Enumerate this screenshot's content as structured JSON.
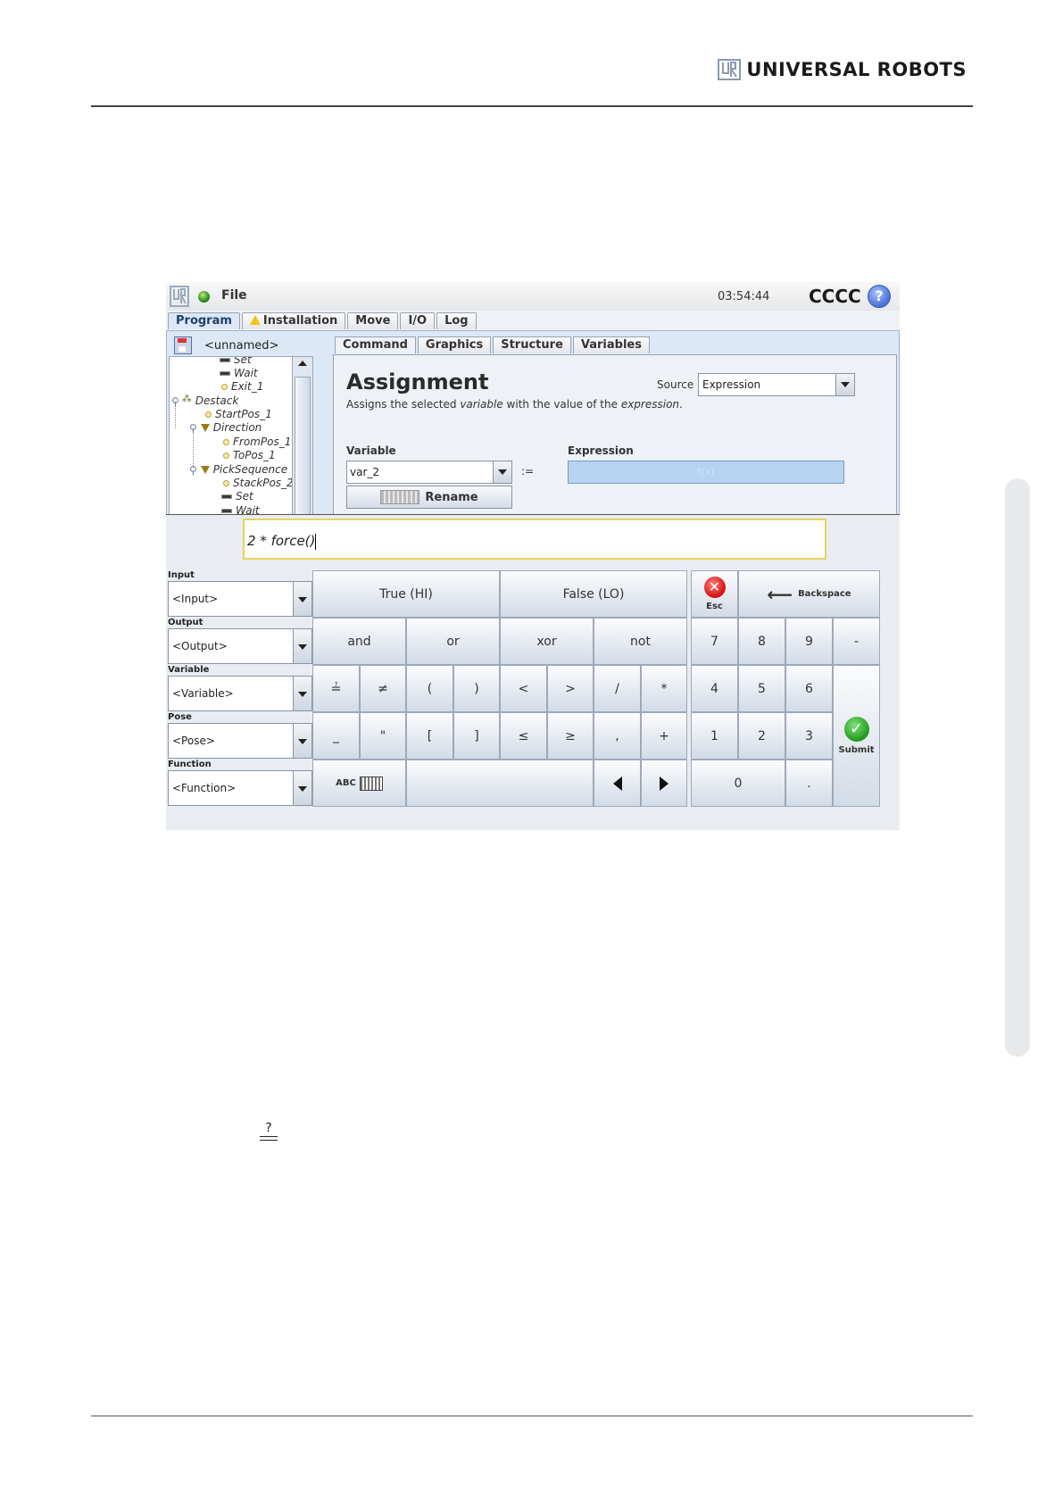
{
  "page": {
    "brand": "UNIVERSAL ROBOTS",
    "qeq_symbol_question": "?",
    "qeq_symbol_equals": "="
  },
  "window": {
    "menu_file": "File",
    "clock": "03:54:44",
    "robot_name": "CCCC",
    "help": "?",
    "status_color": "#2c8a1f"
  },
  "main_tabs": [
    {
      "label": "Program",
      "active": true
    },
    {
      "label": "Installation",
      "icon": "warning-icon"
    },
    {
      "label": "Move"
    },
    {
      "label": "I/O"
    },
    {
      "label": "Log"
    }
  ],
  "tree": {
    "title": "<unnamed>",
    "items": [
      {
        "label": "Set",
        "icon": "set-icon"
      },
      {
        "label": "Wait",
        "icon": "wait-icon"
      },
      {
        "label": "Exit_1",
        "icon": "waypoint-icon"
      },
      {
        "label": "Destack",
        "icon": "pallet-icon"
      },
      {
        "label": "StartPos_1",
        "icon": "waypoint-icon"
      },
      {
        "label": "Direction",
        "icon": "direction-icon"
      },
      {
        "label": "FromPos_1",
        "icon": "waypoint-icon"
      },
      {
        "label": "ToPos_1",
        "icon": "waypoint-icon"
      },
      {
        "label": "PickSequence",
        "icon": "sequence-icon"
      },
      {
        "label": "StackPos_2",
        "icon": "waypoint-icon"
      },
      {
        "label": "Set",
        "icon": "set-icon"
      },
      {
        "label": "Wait",
        "icon": "wait-icon"
      }
    ]
  },
  "sub_tabs": [
    {
      "label": "Command",
      "active": true
    },
    {
      "label": "Graphics"
    },
    {
      "label": "Structure"
    },
    {
      "label": "Variables"
    }
  ],
  "command": {
    "title": "Assignment",
    "desc_pre": "Assigns the selected ",
    "desc_var": "variable",
    "desc_mid": " with the value of the ",
    "desc_expr": "expression",
    "desc_end": ".",
    "source_label": "Source",
    "source_value": "Expression",
    "variable_label": "Variable",
    "variable_value": "var_2",
    "assign_op": ":=",
    "expression_label": "Expression",
    "expression_value": "f(x)",
    "rename_label": "Rename"
  },
  "editor": {
    "expression": "2 * force()",
    "selectors": [
      {
        "label": "Input",
        "value": "<Input>"
      },
      {
        "label": "Output",
        "value": "<Output>"
      },
      {
        "label": "Variable",
        "value": "<Variable>"
      },
      {
        "label": "Pose",
        "value": "<Pose>"
      },
      {
        "label": "Function",
        "value": "<Function>"
      }
    ],
    "keys": {
      "true": "True (HI)",
      "false": "False (LO)",
      "esc": "Esc",
      "backspace": "Backspace",
      "and": "and",
      "or": "or",
      "xor": "xor",
      "not": "not",
      "qeq": "≟",
      "neq": "≠",
      "lparen": "(",
      "rparen": ")",
      "lt": "<",
      "gt": ">",
      "div": "/",
      "mul": "*",
      "underscore": "_",
      "quote": "\"",
      "lbracket": "[",
      "rbracket": "]",
      "le": "≤",
      "ge": "≥",
      "comma": ",",
      "plus": "+",
      "abc": "ABC",
      "n7": "7",
      "n8": "8",
      "n9": "9",
      "minus": "-",
      "n4": "4",
      "n5": "5",
      "n6": "6",
      "n1": "1",
      "n2": "2",
      "n3": "3",
      "n0": "0",
      "dot": ".",
      "submit": "Submit"
    }
  }
}
